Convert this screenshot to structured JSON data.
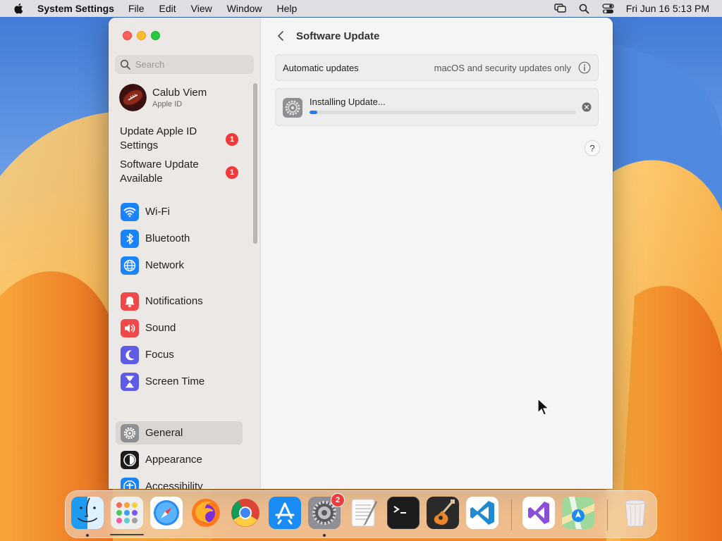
{
  "menubar": {
    "app_name": "System Settings",
    "menus": [
      "File",
      "Edit",
      "View",
      "Window",
      "Help"
    ],
    "clock": "Fri Jun 16  5:13 PM",
    "icons": [
      "apple-icon",
      "screen-mirroring-icon",
      "spotlight-search-icon",
      "control-center-icon"
    ]
  },
  "sidebar": {
    "search_placeholder": "Search",
    "profile": {
      "name": "Calub Viem",
      "subtitle": "Apple ID"
    },
    "alerts": [
      {
        "label": "Update Apple ID Settings",
        "badge": "1"
      },
      {
        "label": "Software Update Available",
        "badge": "1"
      }
    ],
    "items": [
      {
        "label": "Wi-Fi",
        "icon": "wifi-icon",
        "color": "#1a82fb"
      },
      {
        "label": "Bluetooth",
        "icon": "bluetooth-icon",
        "color": "#1a82fb"
      },
      {
        "label": "Network",
        "icon": "globe-icon",
        "color": "#1a82fb"
      },
      {
        "label": "Notifications",
        "icon": "bell-icon",
        "color": "#f0474a"
      },
      {
        "label": "Sound",
        "icon": "speaker-icon",
        "color": "#f0474a"
      },
      {
        "label": "Focus",
        "icon": "moon-icon",
        "color": "#5e5ce6"
      },
      {
        "label": "Screen Time",
        "icon": "hourglass-icon",
        "color": "#5e5ce6"
      },
      {
        "label": "General",
        "icon": "gear-icon",
        "color": "#8e8e93",
        "selected": true
      },
      {
        "label": "Appearance",
        "icon": "appearance-icon",
        "color": "#1c1c1e"
      },
      {
        "label": "Accessibility",
        "icon": "accessibility-icon",
        "color": "#1a82fb"
      }
    ]
  },
  "main": {
    "title": "Software Update",
    "automatic_updates": {
      "label": "Automatic updates",
      "value": "macOS and security updates only"
    },
    "install": {
      "status": "Installing Update...",
      "progress": 0.03
    },
    "help_label": "?"
  },
  "dock": {
    "apps": [
      "Finder",
      "Launchpad",
      "Safari",
      "Firefox",
      "Chrome",
      "App Store",
      "System Settings",
      "TextEdit",
      "Terminal",
      "GarageBand",
      "Visual Studio Code",
      "Visual Studio",
      "Maps",
      "Trash"
    ],
    "system_settings_badge": "2"
  }
}
